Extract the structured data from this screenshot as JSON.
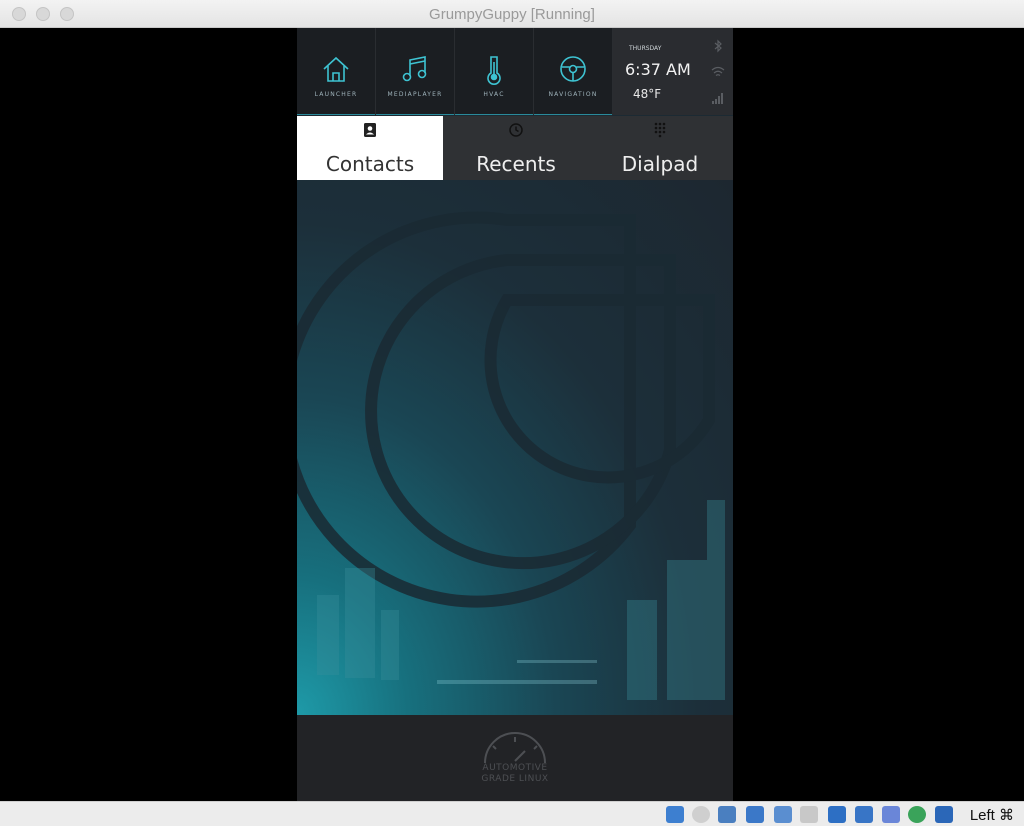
{
  "window": {
    "title": "GrumpyGuppy [Running]"
  },
  "topbar": {
    "shortcuts": [
      {
        "label": "LAUNCHER",
        "icon": "home-icon"
      },
      {
        "label": "MEDIAPLAYER",
        "icon": "music-note-icon"
      },
      {
        "label": "HVAC",
        "icon": "thermometer-icon"
      },
      {
        "label": "NAVIGATION",
        "icon": "steering-wheel-icon"
      }
    ],
    "status": {
      "day": "THURSDAY",
      "time": "6:37 AM",
      "temperature": "48°F"
    }
  },
  "tabs": [
    {
      "label": "Contacts",
      "icon": "contacts-icon",
      "active": true
    },
    {
      "label": "Recents",
      "icon": "clock-icon",
      "active": false
    },
    {
      "label": "Dialpad",
      "icon": "dialpad-icon",
      "active": false
    }
  ],
  "footer": {
    "logo_line1": "AUTOMOTIVE",
    "logo_line2": "GRADE LINUX"
  },
  "statusbar": {
    "host_key": "Left ⌘"
  },
  "colors": {
    "accent": "#2a8a9a",
    "icon": "#3ec3d2"
  }
}
